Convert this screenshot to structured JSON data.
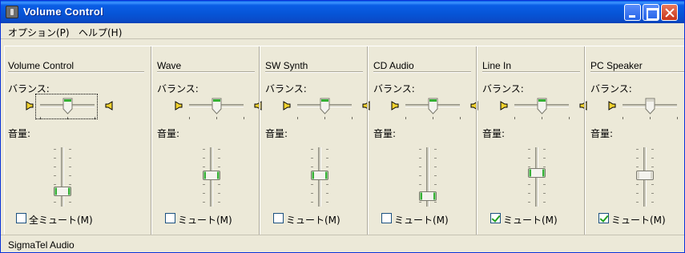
{
  "window": {
    "title": "Volume Control",
    "colors": {
      "titlebar": "#0a5ee6",
      "face": "#ece9d8",
      "close": "#c8341a",
      "checkmark": "#21a121",
      "thumb_accent": "#35b035"
    }
  },
  "menu": {
    "items": [
      {
        "label": "オプション(P)",
        "icon": ""
      },
      {
        "label": "ヘルプ(H)",
        "icon": ""
      }
    ]
  },
  "labels": {
    "balance": "バランス:",
    "volume": "音量:"
  },
  "channels": [
    {
      "name": "Volume Control",
      "balance": 0.5,
      "volume": 0.2,
      "mute_label": "全ミュート(M)",
      "muted": false,
      "focused": true,
      "enabled": true
    },
    {
      "name": "Wave",
      "balance": 0.5,
      "volume": 0.5,
      "mute_label": "ミュート(M)",
      "muted": false,
      "focused": false,
      "enabled": true
    },
    {
      "name": "SW Synth",
      "balance": 0.5,
      "volume": 0.5,
      "mute_label": "ミュート(M)",
      "muted": false,
      "focused": false,
      "enabled": true
    },
    {
      "name": "CD Audio",
      "balance": 0.5,
      "volume": 0.1,
      "mute_label": "ミュート(M)",
      "muted": false,
      "focused": false,
      "enabled": true
    },
    {
      "name": "Line In",
      "balance": 0.5,
      "volume": 0.55,
      "mute_label": "ミュート(M)",
      "muted": true,
      "focused": false,
      "enabled": true
    },
    {
      "name": "PC Speaker",
      "balance": 0.5,
      "volume": 0.5,
      "mute_label": "ミュート(M)",
      "muted": true,
      "focused": false,
      "enabled": false
    }
  ],
  "status": {
    "text": "SigmaTel Audio"
  }
}
